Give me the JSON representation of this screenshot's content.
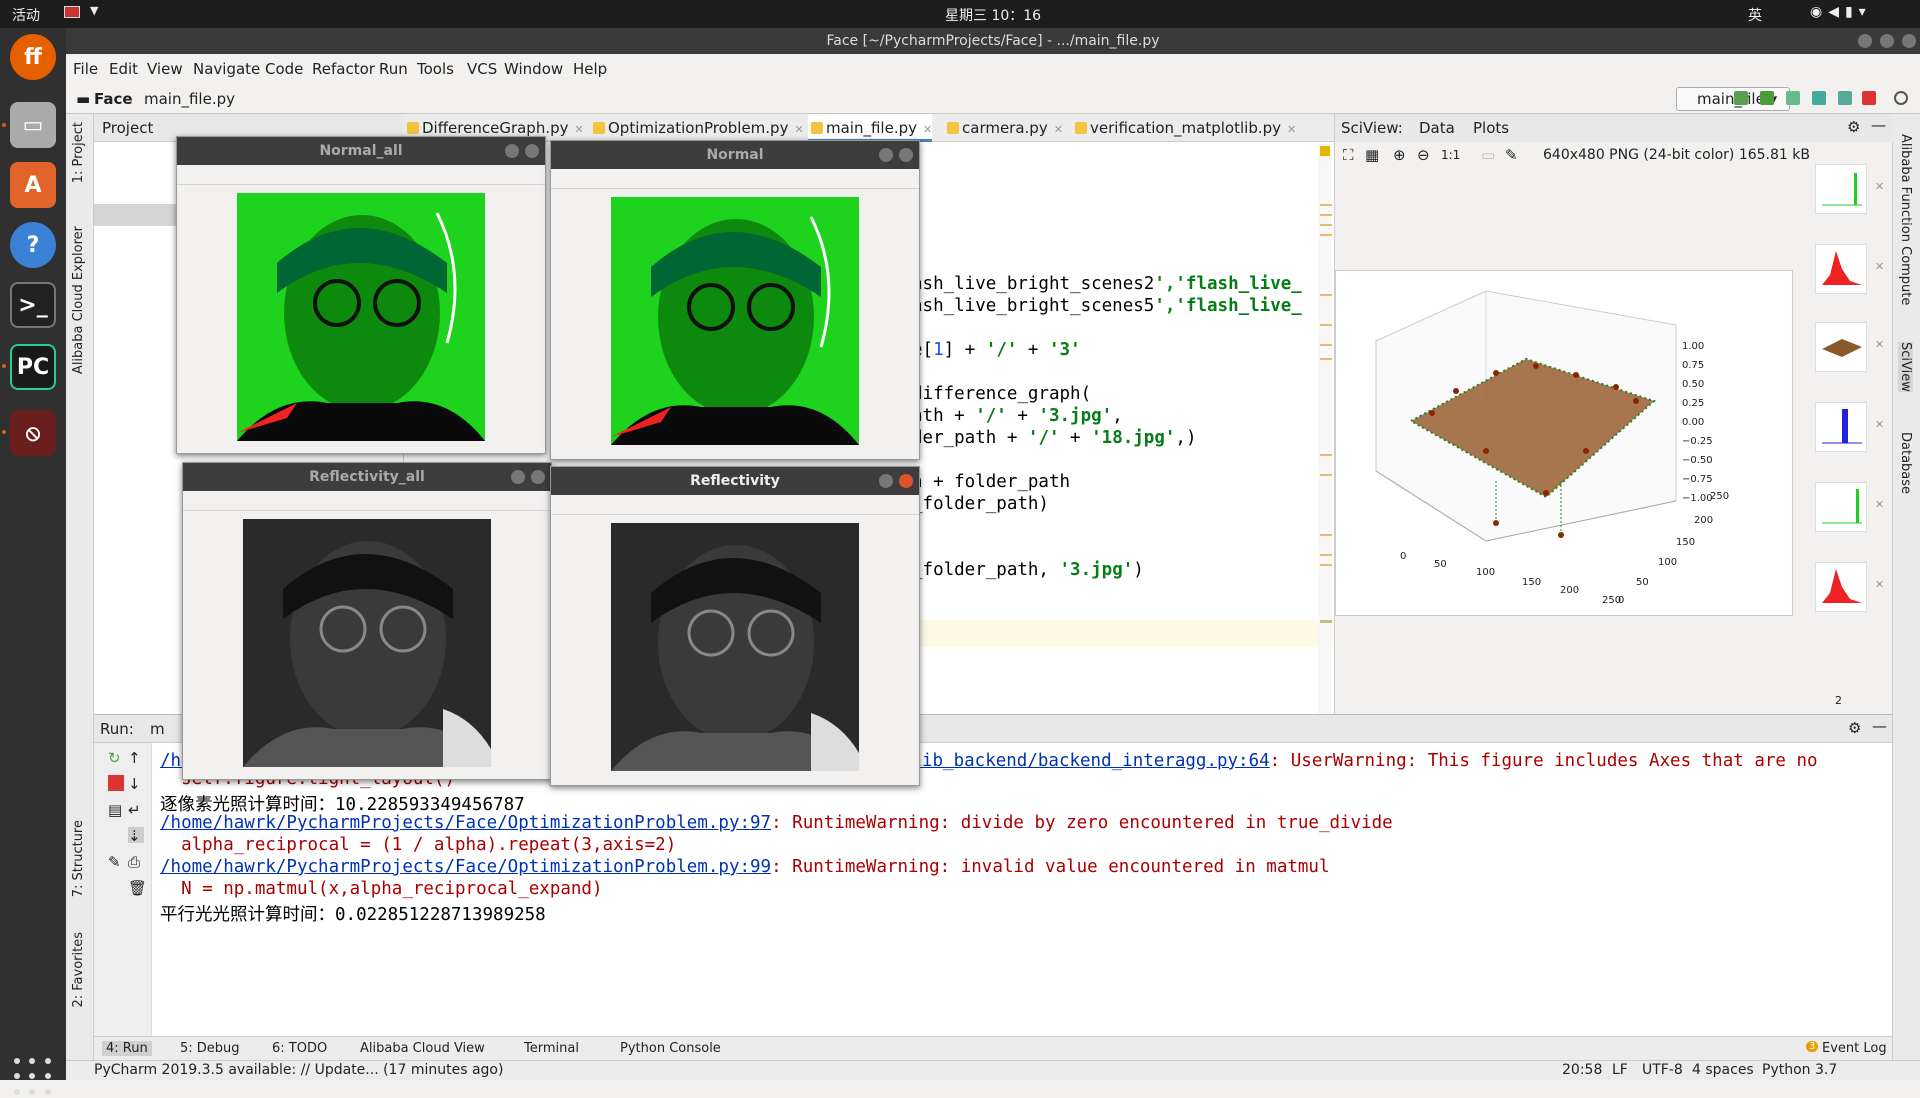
{
  "topbar": {
    "activities": "活动",
    "clock": "星期三 10：16",
    "ime": "英"
  },
  "window": {
    "title": "Face [~/PycharmProjects/Face] - .../main_file.py"
  },
  "menu": [
    "File",
    "Edit",
    "View",
    "Navigate",
    "Code",
    "Refactor",
    "Run",
    "Tools",
    "VCS",
    "Window",
    "Help"
  ],
  "nav": {
    "project": "Face",
    "file": "main_file.py",
    "run_config": "main_file"
  },
  "left_tools": {
    "project": "1: Project",
    "alibaba": "Alibaba Cloud Explorer",
    "structure": "7: Structure",
    "favorites": "2: Favorites"
  },
  "right_tools": {
    "function": "Alibaba Function Compute",
    "sciview": "SciView",
    "database": "Database"
  },
  "project_panel": {
    "title": "Project"
  },
  "tabs": [
    "DifferenceGraph.py",
    "OptimizationProblem.py",
    "main_file.py",
    "carmera.py",
    "verification_matplotlib.py"
  ],
  "code_lines": [
    {
      "t": "ash_live_bright_scenes2','flash_live_"
    },
    {
      "t": "ash_live_bright_scenes5','flash_live_"
    },
    {
      "t": "e[1] + '/' + '3'"
    },
    {
      "t": "difference_graph("
    },
    {
      "t": "ath + '/' + '3.jpg',"
    },
    {
      "t": "der_path + '/' + '18.jpg',)"
    },
    {
      "t": "h + folder_path"
    },
    {
      "t": "_folder_path)"
    },
    {
      "t": "_folder_path, '3.jpg')"
    }
  ],
  "sciview": {
    "title": "SciView:",
    "tab_data": "Data",
    "tab_plots": "Plots",
    "image_info": "640x480 PNG (24-bit color) 165.81 kB",
    "zoom_label": "1:1",
    "thumb_count": "2",
    "z_ticks": [
      "1.00",
      "0.75",
      "0.50",
      "0.25",
      "0.00",
      "−0.25",
      "−0.50",
      "−0.75",
      "−1.00"
    ],
    "x_ticks": [
      "0",
      "50",
      "100",
      "150",
      "200",
      "250"
    ],
    "y_ticks": [
      "250",
      "200",
      "150",
      "100",
      "50",
      "0"
    ]
  },
  "run": {
    "label": "Run:",
    "tab": "m"
  },
  "console": [
    {
      "link": "/home/hawrk/下载/pycharm-2019.3.3/plugins/python/helpers/pycharm_matplotlib_backend/backend_interagg.py:64",
      "warn": ": UserWarning: This figure includes Axes that are no"
    },
    {
      "warn": "  self.figure.tight_layout()"
    },
    {
      "out": "逐像素光照计算时间：10.228593349456787"
    },
    {
      "link": "/home/hawrk/PycharmProjects/Face/OptimizationProblem.py:97",
      "warn": ": RuntimeWarning: divide by zero encountered in true_divide"
    },
    {
      "warn": "  alpha_reciprocal = (1 / alpha).repeat(3,axis=2)"
    },
    {
      "link": "/home/hawrk/PycharmProjects/Face/OptimizationProblem.py:99",
      "warn": ": RuntimeWarning: invalid value encountered in matmul"
    },
    {
      "warn": "  N = np.matmul(x,alpha_reciprocal_expand)"
    },
    {
      "out": "平行光光照计算时间：0.022851228713989258"
    }
  ],
  "bottom_tabs": [
    "4: Run",
    "5: Debug",
    "6: TODO",
    "Alibaba Cloud View",
    "Terminal",
    "Python Console",
    "Event Log"
  ],
  "event_badge": "3",
  "status": {
    "message": "PyCharm 2019.3.5 available: // Update... (17 minutes ago)",
    "pos": "20:58",
    "lf": "LF",
    "enc": "UTF-8",
    "indent": "4 spaces",
    "python": "Python 3.7"
  },
  "figures": {
    "normal_all": "Normal_all",
    "normal": "Normal",
    "refl_all": "Reflectivity_all",
    "refl": "Reflectivity"
  },
  "colors": {
    "accent": "#4083c9",
    "warn": "#aa0000",
    "link": "#0033b3",
    "string": "#067d17",
    "green_img": "#22dd22"
  }
}
